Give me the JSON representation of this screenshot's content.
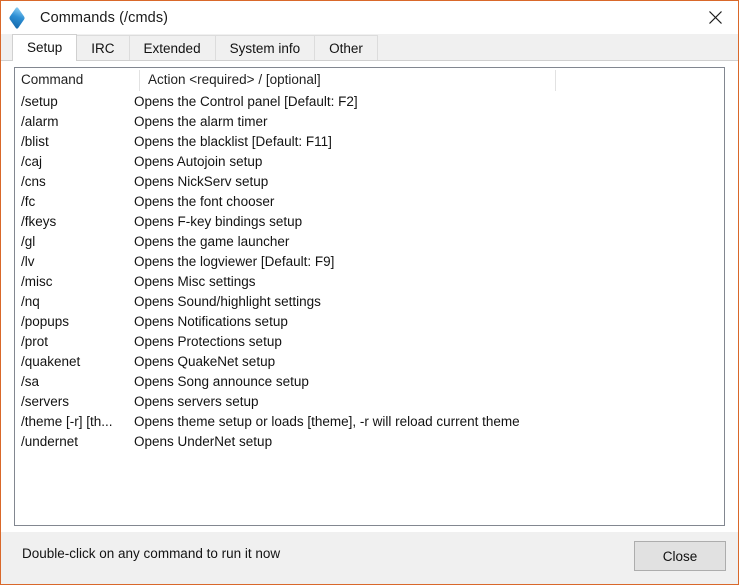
{
  "window": {
    "title": "Commands (/cmds)",
    "icon": "diamond-icon",
    "close_icon": "close-icon",
    "border_color": "#d9682a"
  },
  "tabs": [
    {
      "label": "Setup",
      "active": true
    },
    {
      "label": "IRC",
      "active": false
    },
    {
      "label": "Extended",
      "active": false
    },
    {
      "label": "System info",
      "active": false
    },
    {
      "label": "Other",
      "active": false
    }
  ],
  "list": {
    "headers": [
      "Command",
      "Action   <required> / [optional]",
      ""
    ],
    "rows": [
      {
        "command": "/setup",
        "action": "Opens the Control panel [Default: F2]"
      },
      {
        "command": "/alarm",
        "action": "Opens the alarm timer"
      },
      {
        "command": "/blist",
        "action": "Opens the blacklist [Default: F11]"
      },
      {
        "command": "/caj",
        "action": "Opens Autojoin setup"
      },
      {
        "command": "/cns",
        "action": "Opens NickServ setup"
      },
      {
        "command": "/fc",
        "action": "Opens the font chooser"
      },
      {
        "command": "/fkeys",
        "action": "Opens F-key bindings setup"
      },
      {
        "command": "/gl",
        "action": "Opens the game launcher"
      },
      {
        "command": "/lv",
        "action": "Opens the logviewer [Default: F9]"
      },
      {
        "command": "/misc",
        "action": "Opens Misc settings"
      },
      {
        "command": "/nq",
        "action": "Opens Sound/highlight settings"
      },
      {
        "command": "/popups",
        "action": "Opens Notifications setup"
      },
      {
        "command": "/prot",
        "action": "Opens Protections setup"
      },
      {
        "command": "/quakenet",
        "action": "Opens QuakeNet setup"
      },
      {
        "command": "/sa",
        "action": "Opens Song announce setup"
      },
      {
        "command": "/servers",
        "action": "Opens servers setup"
      },
      {
        "command": "/theme [-r] [th...",
        "action": "Opens theme setup or loads [theme], -r will reload current theme"
      },
      {
        "command": "/undernet",
        "action": "Opens UnderNet setup"
      }
    ]
  },
  "footer": {
    "hint": "Double-click on any command to run it now",
    "close_label": "Close"
  }
}
